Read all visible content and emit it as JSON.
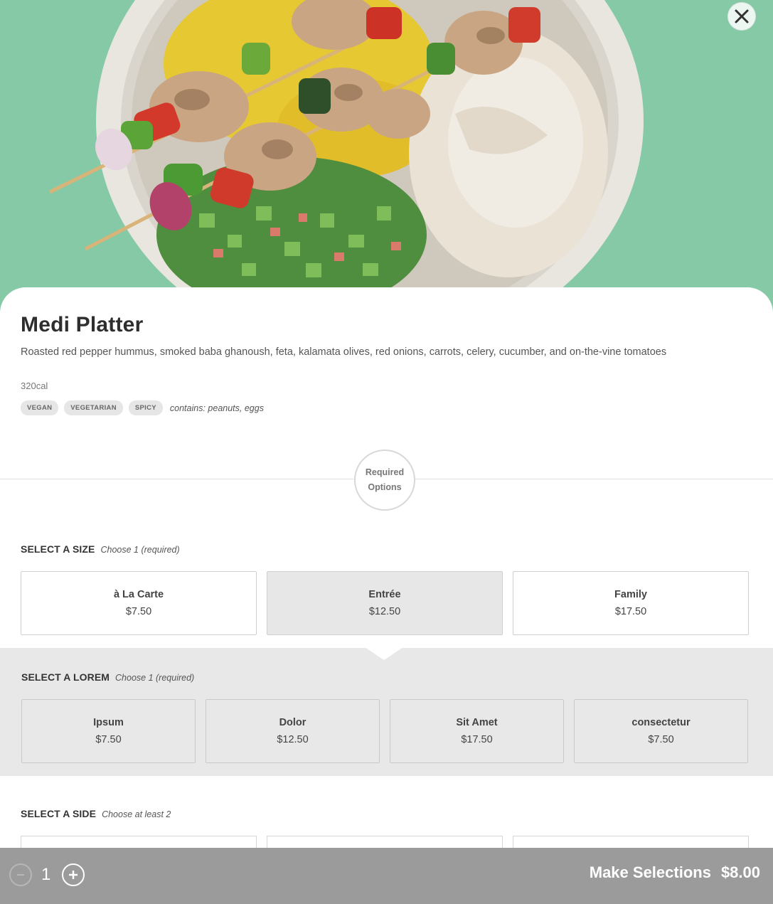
{
  "colors": {
    "accent_gray": "#9b9b9b",
    "background_mint": "#86c9a6",
    "selected_option": "#e7e7e7",
    "panel_gray": "#e8e8e8"
  },
  "icons": {
    "close": "close-icon",
    "minus": "minus-icon",
    "plus": "plus-icon"
  },
  "item": {
    "title": "Medi Platter",
    "description": "Roasted red pepper hummus, smoked baba ghanoush, feta, kalamata olives, red onions, carrots, celery, cucumber, and on-the-vine tomatoes",
    "calories": "320cal",
    "tags": [
      "VEGAN",
      "VEGETARIAN",
      "SPICY"
    ],
    "contains": "contains: peanuts, eggs"
  },
  "required": {
    "line1": "Required",
    "line2": "Options"
  },
  "size_section": {
    "title": "SELECT A SIZE",
    "note": "Choose 1 (required)",
    "options": [
      {
        "name": "à La Carte",
        "price": "$7.50",
        "selected": false
      },
      {
        "name": "Entrée",
        "price": "$12.50",
        "selected": true
      },
      {
        "name": "Family",
        "price": "$17.50",
        "selected": false
      }
    ]
  },
  "lorem_section": {
    "title": "SELECT A LOREM",
    "note": "Choose 1 (required)",
    "options": [
      {
        "name": "Ipsum",
        "price": "$7.50"
      },
      {
        "name": "Dolor",
        "price": "$12.50"
      },
      {
        "name": "Sit Amet",
        "price": "$17.50"
      },
      {
        "name": "consectetur",
        "price": "$7.50"
      }
    ]
  },
  "side_section": {
    "title": "SELECT A SIDE",
    "note": "Choose at least 2"
  },
  "action_bar": {
    "quantity": "1",
    "button_label": "Make Selections",
    "total": "$8.00"
  }
}
